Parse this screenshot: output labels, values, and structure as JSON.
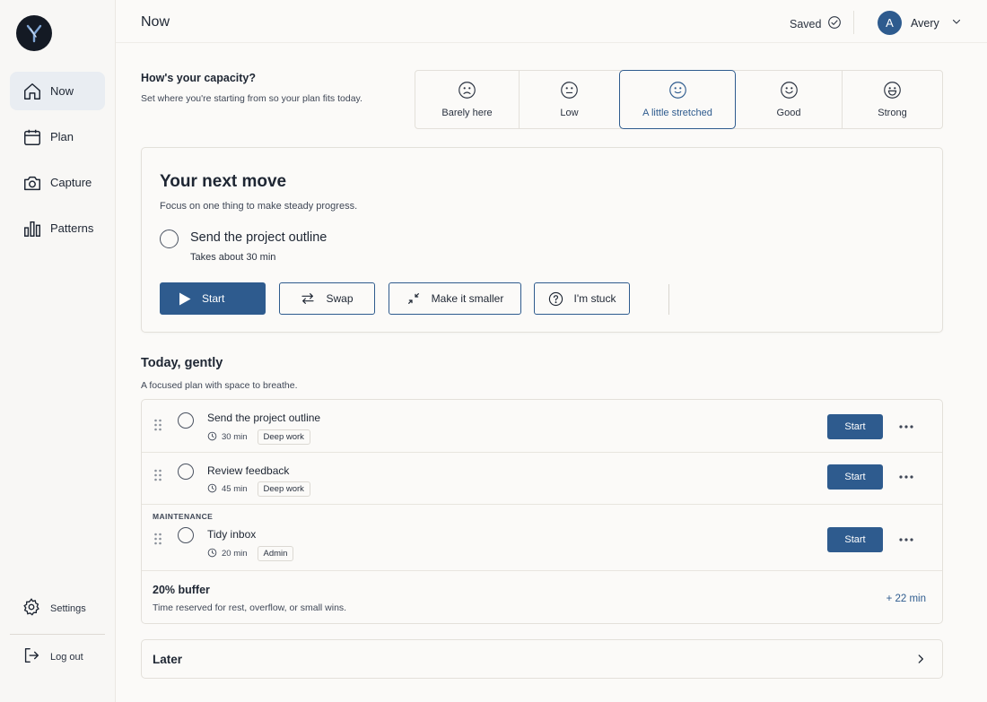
{
  "sidebar": {
    "logo_icon": "app-logo",
    "items": [
      {
        "label": "Now",
        "icon": "home-icon"
      },
      {
        "label": "Plan",
        "icon": "calendar-icon"
      },
      {
        "label": "Capture",
        "icon": "camera-icon"
      },
      {
        "label": "Patterns",
        "icon": "bar-chart-icon"
      }
    ],
    "settings_label": "Settings",
    "logout_label": "Log out"
  },
  "header": {
    "title": "Now",
    "saved_label": "Saved",
    "user_initial": "A",
    "user_name": "Avery"
  },
  "capacity": {
    "title": "How's your capacity?",
    "subtitle": "Set where you're starting from so your plan fits today.",
    "options": [
      {
        "label": "Barely here",
        "icon": "sad-face-icon"
      },
      {
        "label": "Low",
        "icon": "neutral-face-icon"
      },
      {
        "label": "A little stretched",
        "icon": "slight-smile-icon"
      },
      {
        "label": "Good",
        "icon": "smile-icon"
      },
      {
        "label": "Strong",
        "icon": "big-smile-icon"
      }
    ],
    "selected": "A little stretched"
  },
  "next_move": {
    "title": "Your next move",
    "subtitle": "Focus on one thing to make steady progress.",
    "task": "Send the project outline",
    "duration": "Takes about 30 min",
    "buttons": {
      "start": "Start",
      "swap": "Swap",
      "smaller": "Make it smaller",
      "stuck": "I'm stuck"
    }
  },
  "today": {
    "title": "Today, gently",
    "subtitle": "A focused plan with space to breathe.",
    "tasks": [
      {
        "title": "Send the project outline",
        "minutes": "30 min",
        "tag": "Deep work",
        "action": "Start"
      },
      {
        "title": "Review feedback",
        "minutes": "45 min",
        "tag": "Deep work",
        "action": "Start"
      },
      {
        "title": "Tidy inbox",
        "minutes": "20 min",
        "tag": "Admin",
        "action": "Start"
      }
    ],
    "maintenance_label": "MAINTENANCE",
    "buffer": {
      "title": "20% buffer",
      "subtitle": "Time reserved for rest, overflow, or small wins.",
      "value": "+ 22 min"
    }
  },
  "later": {
    "label": "Later"
  },
  "colors": {
    "accent": "#2e5b8e",
    "background": "#fbfaf8",
    "text": "#1e2633"
  }
}
